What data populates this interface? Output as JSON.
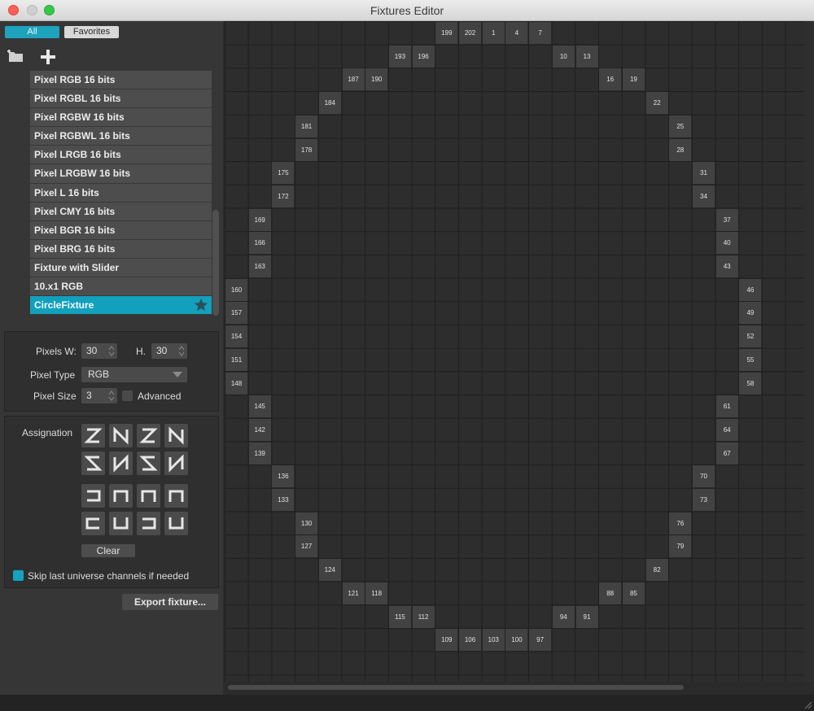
{
  "window": {
    "title": "Fixtures Editor"
  },
  "filters": {
    "all": "All",
    "favorites": "Favorites"
  },
  "fixture_list": [
    "Pixel RGB 16 bits",
    "Pixel RGBL 16 bits",
    "Pixel RGBW 16 bits",
    "Pixel RGBWL 16 bits",
    "Pixel LRGB 16 bits",
    "Pixel LRGBW 16 bits",
    "Pixel L 16 bits",
    "Pixel CMY 16 bits",
    "Pixel BGR 16 bits",
    "Pixel BRG 16 bits",
    "Fixture with Slider",
    "10.x1 RGB",
    "CircleFixture"
  ],
  "selected_fixture": "CircleFixture",
  "properties": {
    "pixels_w_label": "Pixels W:",
    "pixels_w": "30",
    "h_label": "H.",
    "pixels_h": "30",
    "pixel_type_label": "Pixel Type",
    "pixel_type": "RGB",
    "pixel_size_label": "Pixel Size",
    "pixel_size": "3",
    "advanced_label": "Advanced"
  },
  "assignation": {
    "label": "Assignation",
    "clear": "Clear",
    "skip_label": "Skip last universe channels if needed"
  },
  "export": "Export fixture...",
  "colors": {
    "accent": "#12a0bd",
    "cell": "#424242"
  },
  "grid": {
    "columns": 25,
    "rows": 28,
    "cells": [
      {
        "c": 9,
        "r": 0,
        "n": "199"
      },
      {
        "c": 10,
        "r": 0,
        "n": "202"
      },
      {
        "c": 11,
        "r": 0,
        "n": "1"
      },
      {
        "c": 12,
        "r": 0,
        "n": "4"
      },
      {
        "c": 13,
        "r": 0,
        "n": "7"
      },
      {
        "c": 7,
        "r": 1,
        "n": "193"
      },
      {
        "c": 8,
        "r": 1,
        "n": "196"
      },
      {
        "c": 14,
        "r": 1,
        "n": "10"
      },
      {
        "c": 15,
        "r": 1,
        "n": "13"
      },
      {
        "c": 5,
        "r": 2,
        "n": "187"
      },
      {
        "c": 6,
        "r": 2,
        "n": "190"
      },
      {
        "c": 16,
        "r": 2,
        "n": "16"
      },
      {
        "c": 17,
        "r": 2,
        "n": "19"
      },
      {
        "c": 4,
        "r": 3,
        "n": "184"
      },
      {
        "c": 18,
        "r": 3,
        "n": "22"
      },
      {
        "c": 3,
        "r": 4,
        "n": "181"
      },
      {
        "c": 19,
        "r": 4,
        "n": "25"
      },
      {
        "c": 3,
        "r": 5,
        "n": "178"
      },
      {
        "c": 19,
        "r": 5,
        "n": "28"
      },
      {
        "c": 2,
        "r": 6,
        "n": "175"
      },
      {
        "c": 20,
        "r": 6,
        "n": "31"
      },
      {
        "c": 2,
        "r": 7,
        "n": "172"
      },
      {
        "c": 20,
        "r": 7,
        "n": "34"
      },
      {
        "c": 1,
        "r": 8,
        "n": "169"
      },
      {
        "c": 21,
        "r": 8,
        "n": "37"
      },
      {
        "c": 1,
        "r": 9,
        "n": "166"
      },
      {
        "c": 21,
        "r": 9,
        "n": "40"
      },
      {
        "c": 1,
        "r": 10,
        "n": "163"
      },
      {
        "c": 21,
        "r": 10,
        "n": "43"
      },
      {
        "c": 0,
        "r": 11,
        "n": "160"
      },
      {
        "c": 22,
        "r": 11,
        "n": "46"
      },
      {
        "c": 0,
        "r": 12,
        "n": "157"
      },
      {
        "c": 22,
        "r": 12,
        "n": "49"
      },
      {
        "c": 0,
        "r": 13,
        "n": "154"
      },
      {
        "c": 22,
        "r": 13,
        "n": "52"
      },
      {
        "c": 0,
        "r": 14,
        "n": "151"
      },
      {
        "c": 22,
        "r": 14,
        "n": "55"
      },
      {
        "c": 0,
        "r": 15,
        "n": "148"
      },
      {
        "c": 22,
        "r": 15,
        "n": "58"
      },
      {
        "c": 1,
        "r": 16,
        "n": "145"
      },
      {
        "c": 21,
        "r": 16,
        "n": "61"
      },
      {
        "c": 1,
        "r": 17,
        "n": "142"
      },
      {
        "c": 21,
        "r": 17,
        "n": "64"
      },
      {
        "c": 1,
        "r": 18,
        "n": "139"
      },
      {
        "c": 21,
        "r": 18,
        "n": "67"
      },
      {
        "c": 2,
        "r": 19,
        "n": "136"
      },
      {
        "c": 20,
        "r": 19,
        "n": "70"
      },
      {
        "c": 2,
        "r": 20,
        "n": "133"
      },
      {
        "c": 20,
        "r": 20,
        "n": "73"
      },
      {
        "c": 3,
        "r": 21,
        "n": "130"
      },
      {
        "c": 19,
        "r": 21,
        "n": "76"
      },
      {
        "c": 3,
        "r": 22,
        "n": "127"
      },
      {
        "c": 19,
        "r": 22,
        "n": "79"
      },
      {
        "c": 4,
        "r": 23,
        "n": "124"
      },
      {
        "c": 18,
        "r": 23,
        "n": "82"
      },
      {
        "c": 5,
        "r": 24,
        "n": "121"
      },
      {
        "c": 6,
        "r": 24,
        "n": "118"
      },
      {
        "c": 16,
        "r": 24,
        "n": "88"
      },
      {
        "c": 17,
        "r": 24,
        "n": "85"
      },
      {
        "c": 7,
        "r": 25,
        "n": "115"
      },
      {
        "c": 8,
        "r": 25,
        "n": "112"
      },
      {
        "c": 14,
        "r": 25,
        "n": "94"
      },
      {
        "c": 15,
        "r": 25,
        "n": "91"
      },
      {
        "c": 9,
        "r": 26,
        "n": "109"
      },
      {
        "c": 10,
        "r": 26,
        "n": "106"
      },
      {
        "c": 11,
        "r": 26,
        "n": "103"
      },
      {
        "c": 12,
        "r": 26,
        "n": "100"
      },
      {
        "c": 13,
        "r": 26,
        "n": "97"
      }
    ]
  }
}
